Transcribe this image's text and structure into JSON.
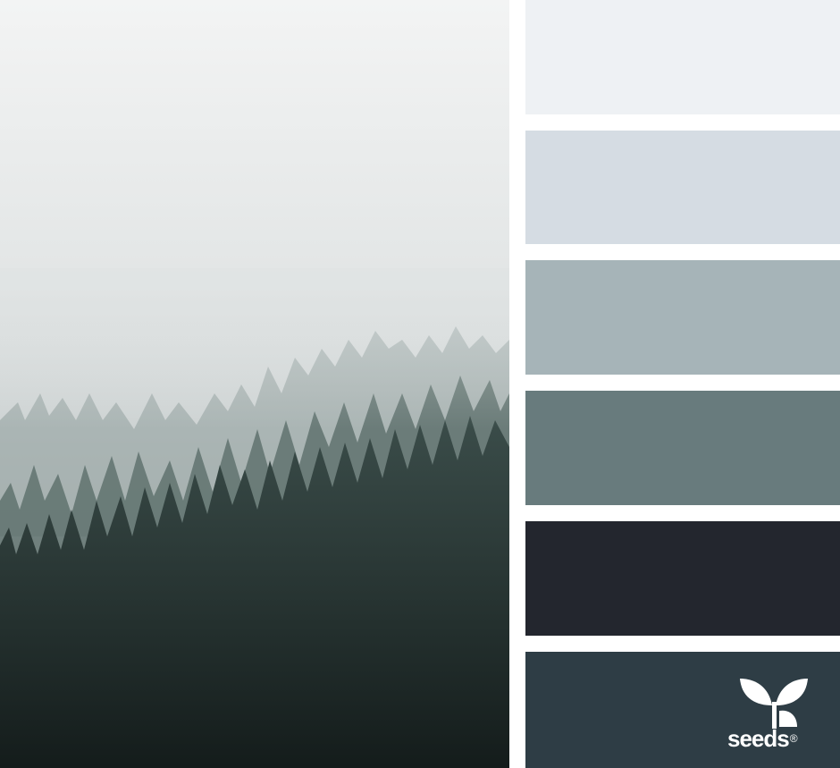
{
  "photo": {
    "subject": "misty-pine-forest-photo"
  },
  "palette": {
    "swatches": [
      {
        "color": "#eef1f4"
      },
      {
        "color": "#d5dce3"
      },
      {
        "color": "#a6b4b8"
      },
      {
        "color": "#687b7d"
      },
      {
        "color": "#23262e"
      },
      {
        "color": "#2e3d45"
      }
    ]
  },
  "logo": {
    "text": "seeds",
    "reg_mark": "®"
  }
}
